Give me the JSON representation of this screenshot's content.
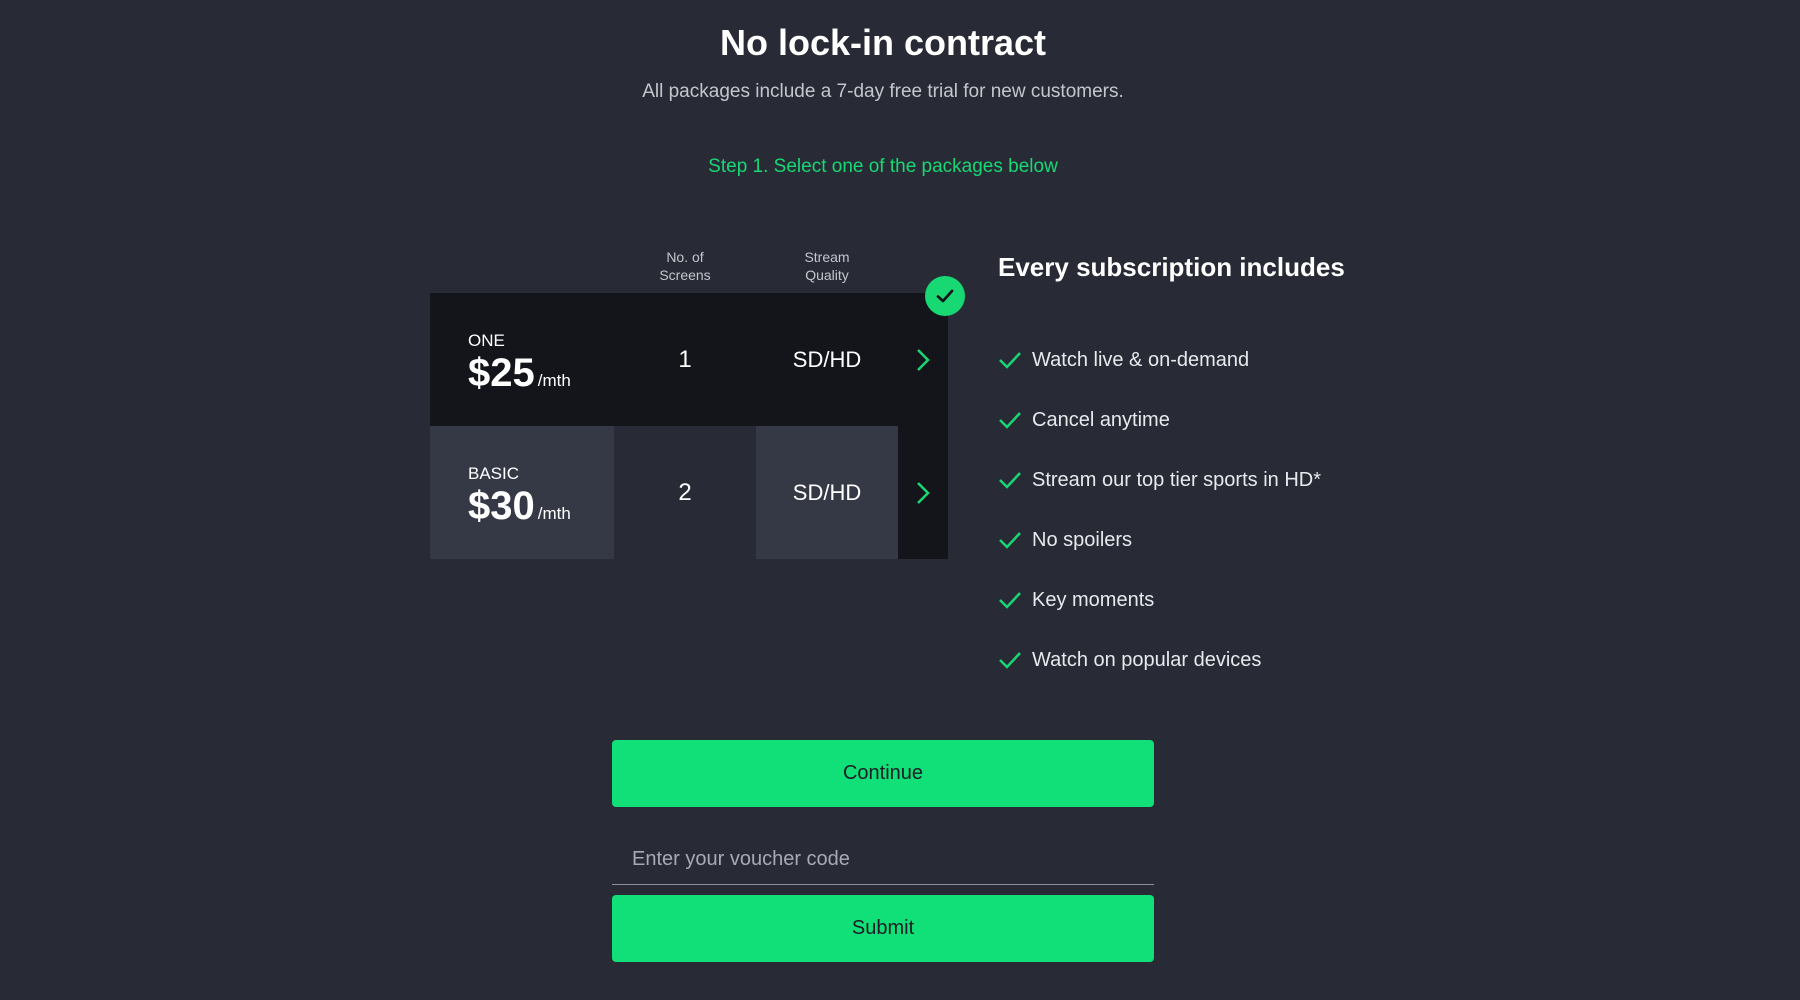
{
  "header": {
    "title": "No lock-in contract",
    "subtitle": "All packages include a 7-day free trial for new customers.",
    "step": "Step 1. Select one of the packages below"
  },
  "table": {
    "columns": {
      "screens": "No. of\nScreens",
      "quality": "Stream\nQuality"
    },
    "selected": "ONE",
    "packages": [
      {
        "name": "ONE",
        "price": "$25",
        "period": "/mth",
        "screens": "1",
        "quality": "SD/HD"
      },
      {
        "name": "BASIC",
        "price": "$30",
        "period": "/mth",
        "screens": "2",
        "quality": "SD/HD"
      }
    ]
  },
  "includes": {
    "title": "Every subscription includes",
    "items": [
      "Watch live & on-demand",
      "Cancel anytime",
      "Stream our top tier sports in HD*",
      "No spoilers",
      "Key moments",
      "Watch on popular devices"
    ]
  },
  "actions": {
    "continue_label": "Continue",
    "voucher_placeholder": "Enter your voucher code",
    "submit_label": "Submit"
  },
  "colors": {
    "background": "#282b36",
    "accent": "#10e077",
    "step_text": "#17d873"
  },
  "icons": {
    "selected": "check-circle-icon",
    "row_arrow": "chevron-right-icon",
    "feature": "check-icon"
  }
}
